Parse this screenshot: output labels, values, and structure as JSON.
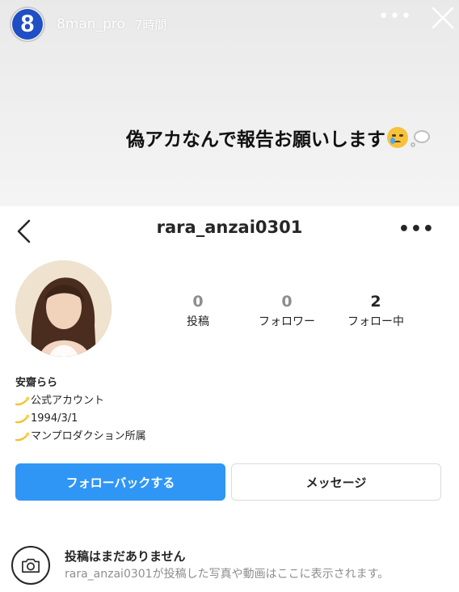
{
  "story": {
    "username": "8man_pro",
    "time": "7時間",
    "avatar_text": "8",
    "more_icon": "ellipsis-icon",
    "close_icon": "close-icon",
    "caption": "偽アカなんで報告お願いします"
  },
  "profile": {
    "title": "rara_anzai0301",
    "back_icon": "chevron-left-icon",
    "more_icon": "ellipsis-icon",
    "stats": [
      {
        "value": "0",
        "label": "投稿"
      },
      {
        "value": "0",
        "label": "フォロワー"
      },
      {
        "value": "2",
        "label": "フォロー中"
      }
    ],
    "bio": {
      "name": "安齋らら",
      "lines": [
        "公式アカウント",
        "1994/3/1",
        "マンプロダクション所属"
      ]
    },
    "buttons": {
      "follow": "フォローバックする",
      "message": "メッセージ"
    },
    "empty": {
      "title": "投稿はまだありません",
      "subtitle": "rara_anzai0301が投稿した写真や動画はここに表示されます。"
    }
  },
  "colors": {
    "accent": "#2f96f5",
    "text": "#262626",
    "muted": "#8e8e8e",
    "brand_badge": "#1f4fc4"
  }
}
